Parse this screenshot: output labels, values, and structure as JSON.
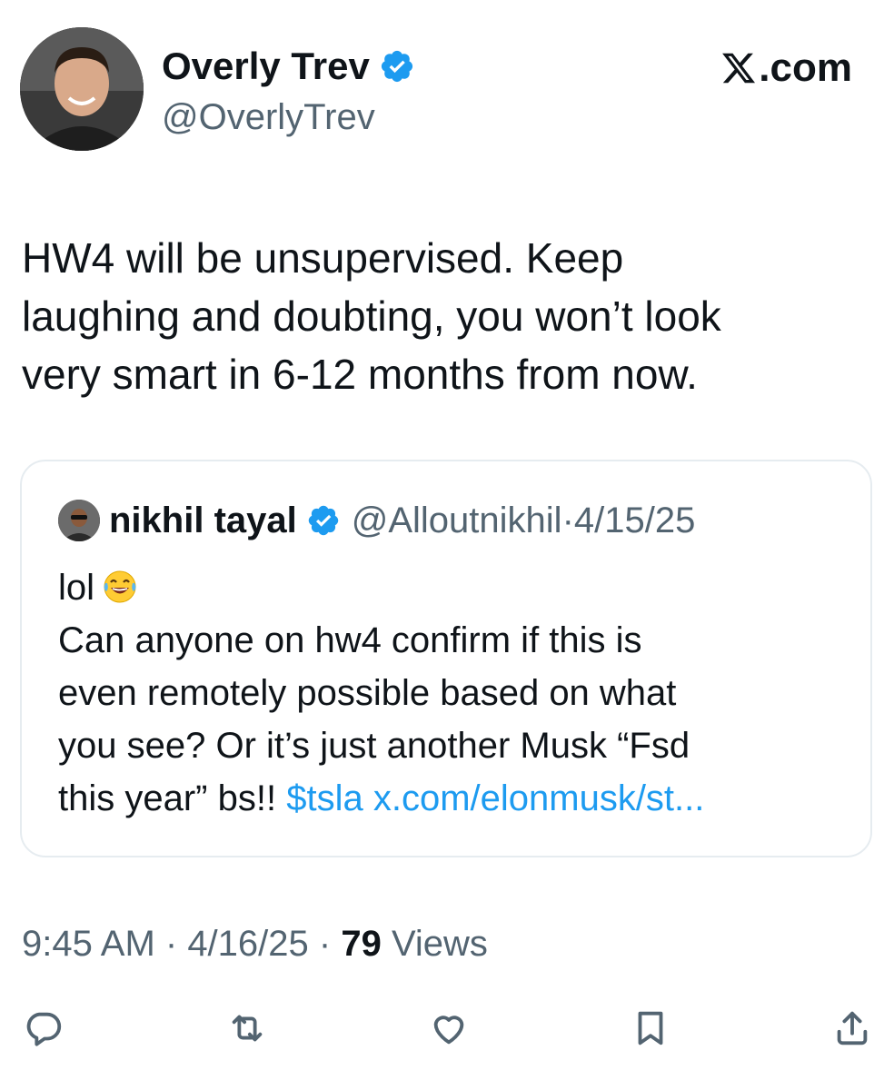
{
  "author": {
    "display_name": "Overly Trev",
    "handle": "@OverlyTrev",
    "verified": true
  },
  "brand": {
    "label": ".com",
    "icon": "x-logo-icon"
  },
  "tweet": {
    "text": "HW4 will be unsupervised. Keep\nlaughing and doubting, you won’t look\nvery smart in 6-12 months from now."
  },
  "quote": {
    "display_name": "nikhil tayal",
    "handle": "@Alloutnikhil",
    "separator": "·",
    "date": "4/15/25",
    "verified": true,
    "line1": "lol",
    "line1_emoji": "face-with-tears-of-joy",
    "line2": "Can anyone on hw4 confirm if this is",
    "line3": "even remotely possible based on what",
    "line4": "you see? Or it’s just another Musk “Fsd",
    "line5_text": "this year” bs!! ",
    "cashtag": "$tsla",
    "url": "x.com/elonmusk/st..."
  },
  "meta": {
    "time": "9:45 AM",
    "dot1": " · ",
    "date": "4/16/25",
    "dot2": " · ",
    "views_count": "79",
    "views_label": " Views"
  },
  "actions": [
    {
      "name": "reply-icon"
    },
    {
      "name": "retweet-icon"
    },
    {
      "name": "like-icon"
    },
    {
      "name": "bookmark-icon"
    },
    {
      "name": "share-icon"
    }
  ],
  "colors": {
    "text": "#0f1419",
    "secondary": "#536471",
    "link": "#1d9bf0",
    "verified": "#1d9bf0",
    "border": "#e6ecf0"
  }
}
